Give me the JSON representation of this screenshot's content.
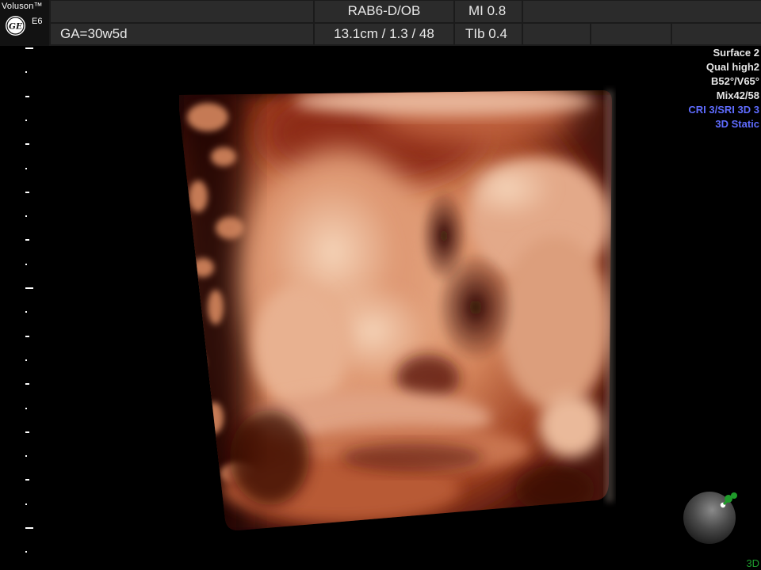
{
  "header": {
    "brand_name": "Voluson™",
    "brand_logo_text": "GE",
    "brand_model": "E6",
    "gestational_age": "GA=30w5d",
    "probe_preset": "RAB6-D/OB",
    "depth_settings": "13.1cm / 1.3 / 48",
    "mechanical_index": "MI  0.8",
    "thermal_index": "TIb  0.4"
  },
  "info_panel": {
    "lines": [
      "Surface 2",
      "Qual high2",
      "B52°/V65°",
      "Mix42/58"
    ],
    "blue_lines": [
      "CRI 3/SRI 3D 3",
      "3D Static"
    ]
  },
  "mode_tag": "3D",
  "icons": {
    "brand": "ge-logo-icon",
    "orientation": "orientation-ball-icon",
    "marker": "green-pin-icon"
  },
  "colors": {
    "render_highlight": "#f3c9a4",
    "render_mid": "#cf7048",
    "render_shadow": "#6e1c0c",
    "info_blue": "#5f6cff",
    "marker_green": "#1f9a2a"
  }
}
